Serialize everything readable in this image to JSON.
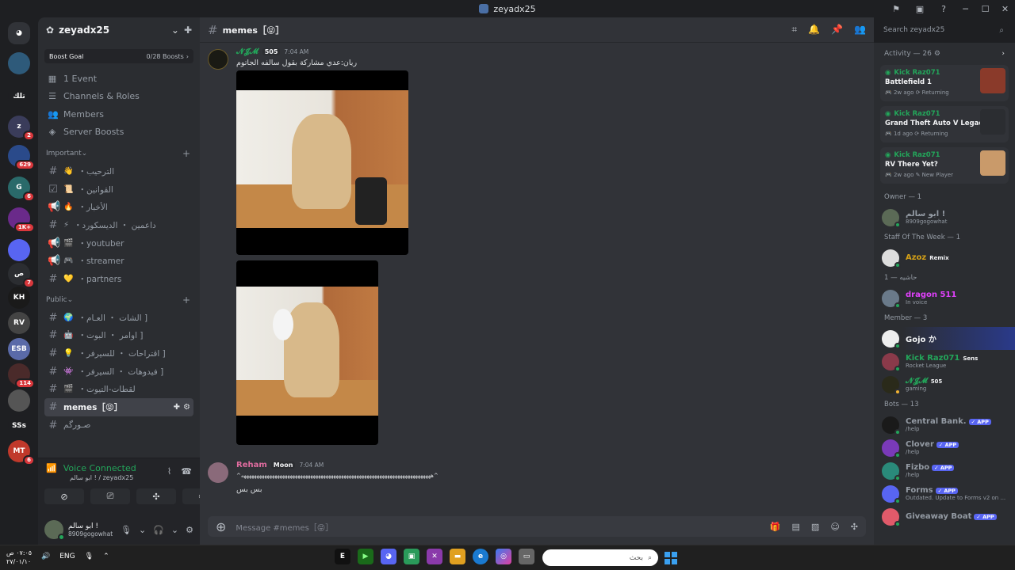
{
  "window": {
    "title": "zeyadx25"
  },
  "rail": {
    "servers": [
      {
        "abbr": "",
        "color": "#2e5a7a",
        "badge": ""
      },
      {
        "abbr": "تلك",
        "color": "#1e1f22",
        "badge": ""
      },
      {
        "abbr": "z",
        "color": "#3a3c5a",
        "badge": "2"
      },
      {
        "abbr": "",
        "color": "#2a4a8a",
        "badge": "629"
      },
      {
        "abbr": "G",
        "color": "#2a6a6a",
        "badge": "6"
      },
      {
        "abbr": "",
        "color": "#6a2a8a",
        "badge": "1K+"
      },
      {
        "abbr": "",
        "color": "#5865f2",
        "badge": ""
      },
      {
        "abbr": "ص",
        "color": "#2b2d31",
        "badge": "7"
      },
      {
        "abbr": "KH",
        "color": "#1a1a1a",
        "badge": ""
      },
      {
        "abbr": "RV",
        "color": "#444",
        "badge": ""
      },
      {
        "abbr": "ESB",
        "color": "#5a6aa8",
        "badge": ""
      },
      {
        "abbr": "",
        "color": "#4a2a2a",
        "badge": "114"
      },
      {
        "abbr": "",
        "color": "#555",
        "badge": ""
      },
      {
        "abbr": "SSs",
        "color": "#1e1f22",
        "badge": ""
      },
      {
        "abbr": "MT",
        "color": "#c0392b",
        "badge": "6"
      }
    ]
  },
  "sidebar": {
    "guild_name": "zeyadx25",
    "boost": {
      "label": "Boost Goal",
      "count": "0/28 Boosts"
    },
    "nav": [
      {
        "icon": "calendar-icon",
        "glyph": "▦",
        "label": "1 Event"
      },
      {
        "icon": "channels-icon",
        "glyph": "☰",
        "label": "Channels & Roles"
      },
      {
        "icon": "members-icon",
        "glyph": "👥",
        "label": "Members"
      },
      {
        "icon": "boost-icon",
        "glyph": "◈",
        "label": "Server Boosts"
      }
    ],
    "categories": [
      {
        "name": "Important",
        "channels": [
          {
            "type": "#",
            "emoji": "👋",
            "label": "・الترحيب"
          },
          {
            "type": "☑",
            "emoji": "📜",
            "label": "・القوانين"
          },
          {
            "type": "📢",
            "emoji": "🔥",
            "label": "・الأخبار"
          },
          {
            "type": "#",
            "emoji": "⚡",
            "label": "・داعمين ・ الديسكورد"
          },
          {
            "type": "📢",
            "emoji": "🎬",
            "label": "・youtuber"
          },
          {
            "type": "📢",
            "emoji": "🎮",
            "label": "・streamer"
          },
          {
            "type": "#",
            "emoji": "💛",
            "label": "・partners"
          }
        ]
      },
      {
        "name": "Public",
        "channels": [
          {
            "type": "#",
            "emoji": "🌍",
            "label": "・الشات ・ العـام ]"
          },
          {
            "type": "#",
            "emoji": "🤖",
            "label": "・اوامر ・ البوت ]"
          },
          {
            "type": "#",
            "emoji": "💡",
            "label": "・اقتراحات ・ للسيرفر ]"
          },
          {
            "type": "#",
            "emoji": "👾",
            "label": "・فيدوهات ・ السيرفر ]"
          },
          {
            "type": "#",
            "emoji": "🎬",
            "label": "・لقطات-التيوت"
          }
        ]
      }
    ],
    "active_channel": "memes［😝］",
    "below_active": "صـورگم",
    "voice": {
      "status": "Voice Connected",
      "sub": "ابو سالم ! / zeyadx25"
    },
    "user": {
      "name": "ابو سالم !",
      "status": "8909gogowhat"
    }
  },
  "channel": {
    "name": "memes［😝］",
    "search_placeholder": "Search zeyadx25",
    "composer_placeholder": "Message #memes［😝］"
  },
  "messages": [
    {
      "author": "𝓝𝓙𝓜",
      "author_color": "#23a55a",
      "tag": "505",
      "time": "7:04 AM",
      "text": "ريان:عدي مشاركة بقول سالفه الجاتوم"
    },
    {
      "author": "Reham",
      "author_color": "#e06c9f",
      "tag": "Moon",
      "time": "7:04 AM",
      "text": "^ههههههههههههههههههههههههههههههههههههههههههههههههههههههههههههههههههههههههههه^",
      "text2": "بس بس"
    }
  ],
  "members_panel": {
    "activity_label": "Activity — 26",
    "activities": [
      {
        "user": "Kick Raz071",
        "game": "Battlefield 1",
        "meta": "2w ago  ⟳ Returning",
        "art_color": "#8a3a2a"
      },
      {
        "user": "Kick Raz071",
        "game": "Grand Theft Auto V Legacy",
        "meta": "1d ago  ⟳ Returning",
        "art_color": "#2b2d31"
      },
      {
        "user": "Kick Raz071",
        "game": "RV There Yet?",
        "meta": "2w ago  ✎ New Player",
        "art_color": "#c99a6a"
      }
    ],
    "groups": [
      {
        "title": "Owner — 1",
        "members": [
          {
            "name": "ابو سالم !",
            "sub": "8909gogowhat",
            "color": "#949ba4",
            "av": "#5b6a56",
            "status": "#23a55a",
            "tag": ""
          }
        ]
      },
      {
        "title": "Staff Of The Week — 1",
        "members": [
          {
            "name": "Azoz",
            "sub": "",
            "color": "#d4a017",
            "av": "#ddd",
            "status": "#23a55a",
            "tag": "Remix"
          }
        ]
      },
      {
        "title": "حاشيه — 1",
        "members": [
          {
            "name": "dragon 511",
            "sub": "In voice",
            "color": "#e040fb",
            "av": "#6a7a8a",
            "status": "#23a55a",
            "tag": ""
          }
        ]
      },
      {
        "title": "Member — 3",
        "members": [
          {
            "name": "Gojo か",
            "sub": "",
            "color": "#f2f3f5",
            "av": "#eee",
            "status": "#23a55a",
            "tag": ""
          },
          {
            "name": "Kick Raz071",
            "sub": "Rocket League",
            "color": "#23a55a",
            "av": "#8a3a4a",
            "status": "#23a55a",
            "tag": "Sens"
          },
          {
            "name": "𝓝𝓙𝓜",
            "sub": "gaming",
            "color": "#23a55a",
            "av": "#2a2a1a",
            "status": "#f0b232",
            "tag": "505"
          }
        ]
      },
      {
        "title": "Bots — 13",
        "members": [
          {
            "name": "Central Bank.",
            "sub": "/help",
            "color": "#949ba4",
            "av": "#1a1a1a",
            "status": "#23a55a",
            "tag": "APP"
          },
          {
            "name": "Clover",
            "sub": "/help",
            "color": "#949ba4",
            "av": "#7a3ab8",
            "status": "#23a55a",
            "tag": "APP"
          },
          {
            "name": "Fizbo",
            "sub": "/help",
            "color": "#949ba4",
            "av": "#2a8a7a",
            "status": "#23a55a",
            "tag": "APP"
          },
          {
            "name": "Forms",
            "sub": "Outdated. Update to Forms v2 on ...",
            "color": "#949ba4",
            "av": "#5865f2",
            "status": "#23a55a",
            "tag": "APP"
          },
          {
            "name": "Giveaway Boat",
            "sub": "",
            "color": "#949ba4",
            "av": "#e05a6a",
            "status": "#23a55a",
            "tag": "APP"
          }
        ]
      }
    ]
  },
  "taskbar": {
    "time": "٠٧:٠٥ ص",
    "date": "٢٧/٠١/١٠",
    "lang": "ENG",
    "search_placeholder": "بحث"
  }
}
